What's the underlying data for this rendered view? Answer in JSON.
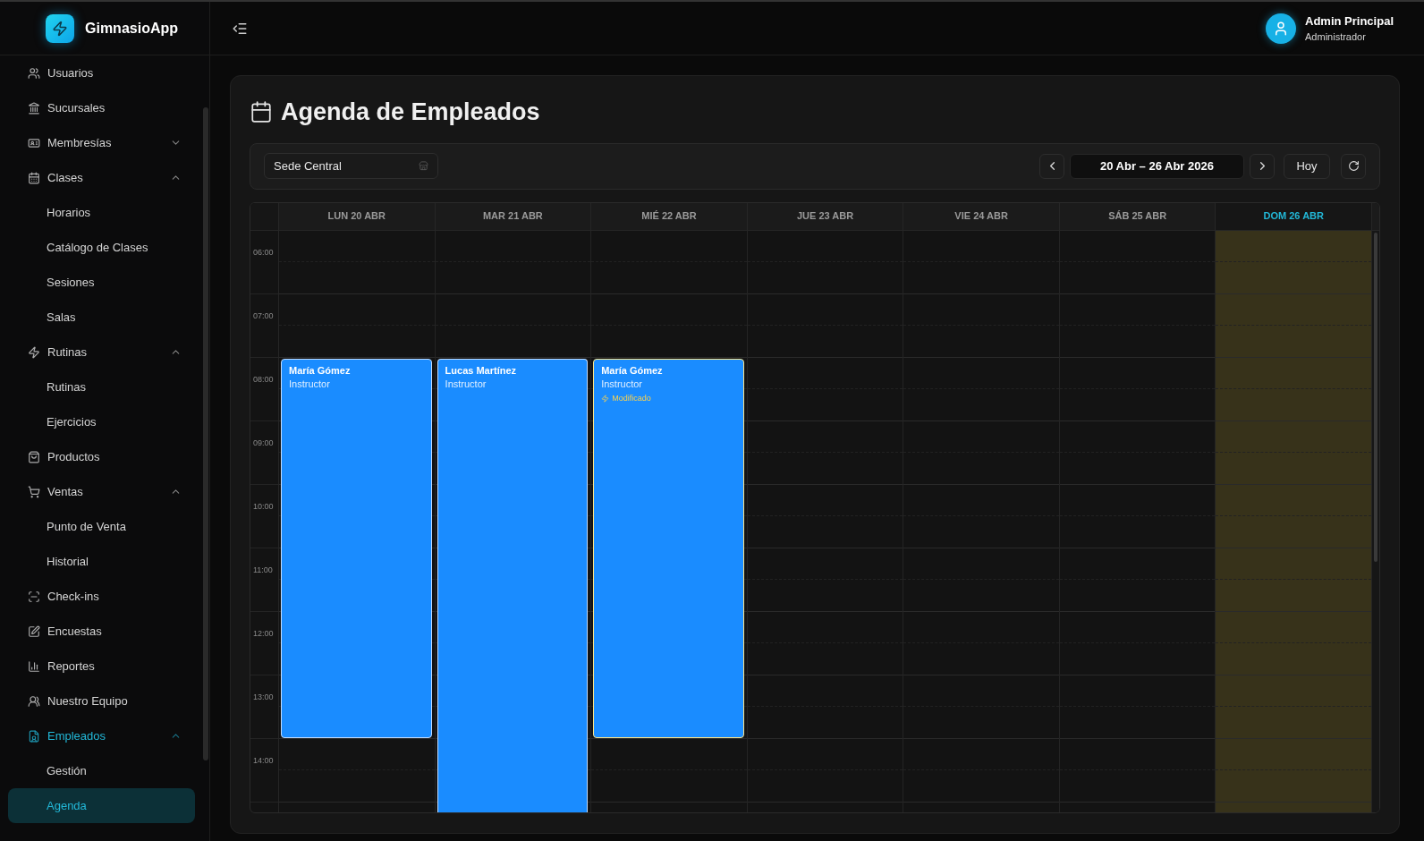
{
  "app": {
    "name": "GimnasioApp"
  },
  "user": {
    "name": "Admin Principal",
    "role": "Administrador"
  },
  "sidebar": {
    "items": [
      {
        "label": "Usuarios",
        "selected": false
      },
      {
        "label": "Sucursales",
        "selected": false
      },
      {
        "label": "Membresías",
        "expanded": false,
        "selected": false
      },
      {
        "label": "Clases",
        "expanded": true,
        "selected": false,
        "children": [
          {
            "label": "Horarios",
            "selected": false
          },
          {
            "label": "Catálogo de Clases",
            "selected": false
          },
          {
            "label": "Sesiones",
            "selected": false
          },
          {
            "label": "Salas",
            "selected": false
          }
        ]
      },
      {
        "label": "Rutinas",
        "expanded": true,
        "selected": false,
        "children": [
          {
            "label": "Rutinas",
            "selected": false
          },
          {
            "label": "Ejercicios",
            "selected": false
          }
        ]
      },
      {
        "label": "Productos",
        "selected": false
      },
      {
        "label": "Ventas",
        "expanded": true,
        "selected": false,
        "children": [
          {
            "label": "Punto de Venta",
            "selected": false
          },
          {
            "label": "Historial",
            "selected": false
          }
        ]
      },
      {
        "label": "Check-ins",
        "selected": false
      },
      {
        "label": "Encuestas",
        "selected": false
      },
      {
        "label": "Reportes",
        "selected": false
      },
      {
        "label": "Nuestro Equipo",
        "selected": false
      },
      {
        "label": "Empleados",
        "expanded": true,
        "selected": true,
        "children": [
          {
            "label": "Gestión",
            "selected": false
          },
          {
            "label": "Agenda",
            "selected": true
          }
        ]
      }
    ]
  },
  "page": {
    "title": "Agenda de Empleados"
  },
  "toolbar": {
    "branch": "Sede Central",
    "range": "20 Abr – 26 Abr 2026",
    "today_button": "Hoy"
  },
  "calendar": {
    "hours": [
      "06:00",
      "07:00",
      "08:00",
      "09:00",
      "10:00",
      "11:00",
      "12:00",
      "13:00",
      "14:00"
    ],
    "days": [
      {
        "label": "LUN 20 ABR",
        "selected": false,
        "events": [
          {
            "name": "María Gómez",
            "role": "Instructor",
            "extends_past_view": false,
            "modified": false
          }
        ]
      },
      {
        "label": "MAR 21 ABR",
        "selected": false,
        "events": [
          {
            "name": "Lucas Martínez",
            "role": "Instructor",
            "extends_past_view": true,
            "modified": false
          }
        ]
      },
      {
        "label": "MIÉ 22 ABR",
        "selected": false,
        "events": [
          {
            "name": "María Gómez",
            "role": "Instructor",
            "extends_past_view": false,
            "modified": true,
            "badge": "Modificado"
          }
        ]
      },
      {
        "label": "JUE 23 ABR",
        "selected": false
      },
      {
        "label": "VIE 24 ABR",
        "selected": false
      },
      {
        "label": "SÁB 25 ABR",
        "selected": false
      },
      {
        "label": "DOM 26 ABR",
        "selected": true
      }
    ]
  }
}
